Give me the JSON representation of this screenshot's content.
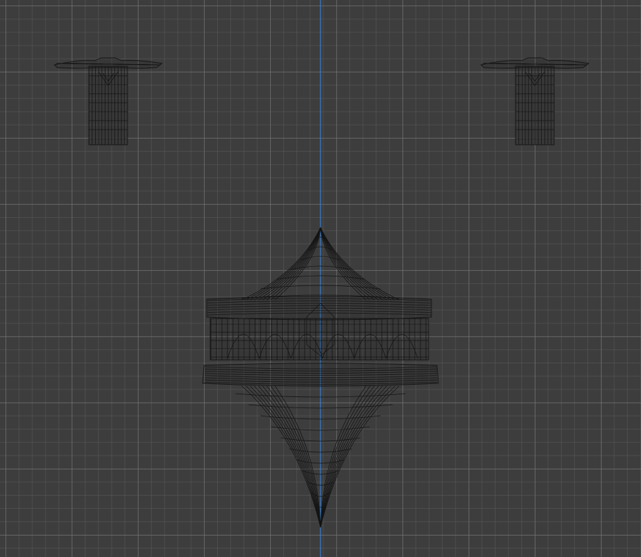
{
  "viewport": {
    "background_color": "#3d3d3d",
    "grid_color_major": "#5a5a5a",
    "grid_color_minor": "#4a4a4a",
    "axis_color": "#3a7fd0",
    "wire_color": "#141414"
  },
  "objects": [
    {
      "name": "bolt-left",
      "type": "wireframe-mesh"
    },
    {
      "name": "bolt-right",
      "type": "wireframe-mesh"
    },
    {
      "name": "ornament-center",
      "type": "wireframe-mesh"
    }
  ]
}
